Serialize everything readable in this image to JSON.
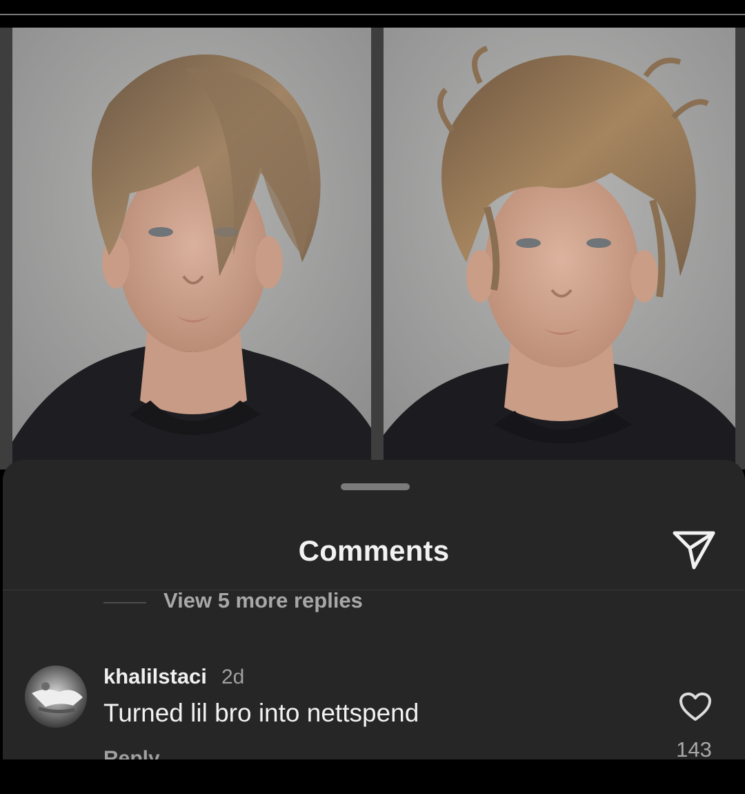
{
  "photos": [
    {
      "name": "portrait-before"
    },
    {
      "name": "portrait-after"
    }
  ],
  "comments_sheet": {
    "title": "Comments",
    "view_replies": "View 5 more replies",
    "share_icon": "paper-plane-icon"
  },
  "comment": {
    "username": "khalilstaci",
    "time": "2d",
    "text": "Turned lil bro into nettspend",
    "reply_label": "Reply",
    "like_icon": "heart-icon",
    "like_count": "143"
  },
  "colors": {
    "sheet_bg": "#262626",
    "text_primary": "#f2f2f2",
    "text_secondary": "#a8a8a8"
  }
}
